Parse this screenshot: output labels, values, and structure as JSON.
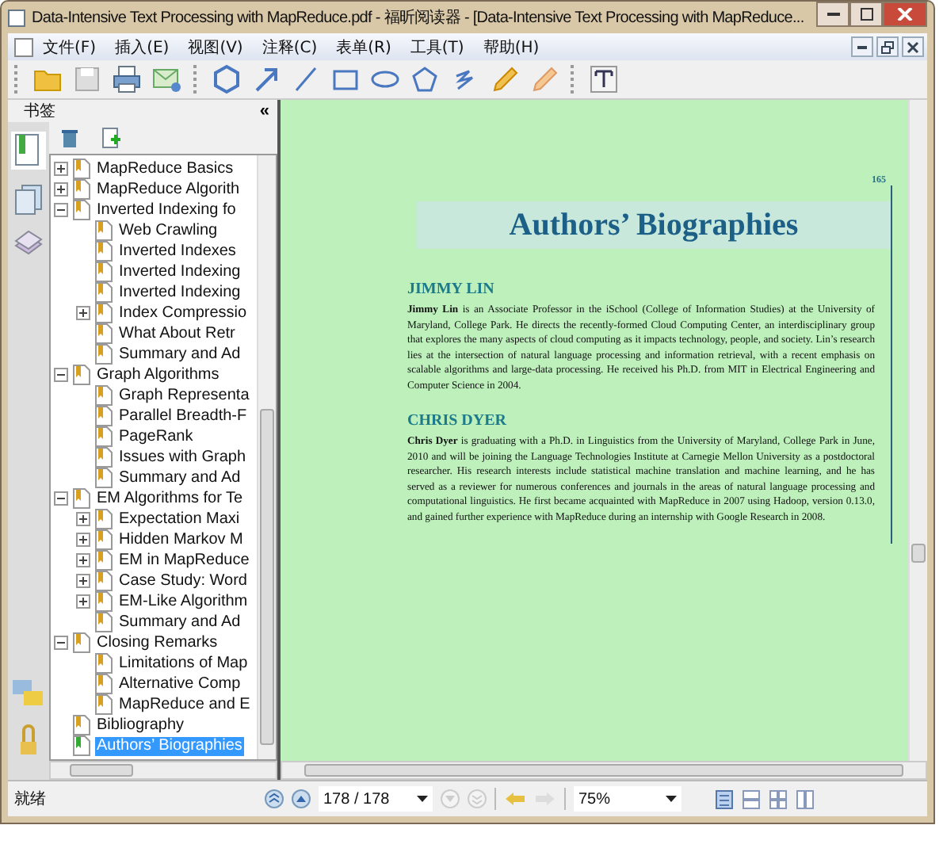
{
  "window": {
    "title": "Data-Intensive Text Processing with MapReduce.pdf - 福昕阅读器 - [Data-Intensive Text Processing with MapReduce..."
  },
  "menu": [
    "文件(F)",
    "插入(E)",
    "视图(V)",
    "注释(C)",
    "表单(R)",
    "工具(T)",
    "帮助(H)"
  ],
  "panel": {
    "title": "书签",
    "collapse": "«"
  },
  "bookmarks": [
    {
      "label": "MapReduce Basics",
      "expanded": false,
      "selected": false
    },
    {
      "label": "MapReduce Algorith",
      "expanded": false,
      "selected": false
    },
    {
      "label": "Inverted Indexing fo",
      "expanded": true,
      "selected": false,
      "children": [
        {
          "label": "Web Crawling",
          "selected": false
        },
        {
          "label": "Inverted Indexes",
          "selected": false
        },
        {
          "label": "Inverted Indexing",
          "selected": false
        },
        {
          "label": "Inverted Indexing",
          "selected": false
        },
        {
          "label": "Index Compressio",
          "expanded": false,
          "selected": false
        },
        {
          "label": "What About Retr",
          "selected": false
        },
        {
          "label": "Summary and Ad",
          "selected": false
        }
      ]
    },
    {
      "label": "Graph Algorithms",
      "expanded": true,
      "selected": false,
      "children": [
        {
          "label": "Graph Representa",
          "selected": false
        },
        {
          "label": "Parallel Breadth-F",
          "selected": false
        },
        {
          "label": "PageRank",
          "selected": false
        },
        {
          "label": "Issues with Graph",
          "selected": false
        },
        {
          "label": "Summary and Ad",
          "selected": false
        }
      ]
    },
    {
      "label": "EM Algorithms for Te",
      "expanded": true,
      "selected": false,
      "children": [
        {
          "label": "Expectation Maxi",
          "expanded": false,
          "selected": false
        },
        {
          "label": "Hidden Markov M",
          "expanded": false,
          "selected": false
        },
        {
          "label": "EM in MapReduce",
          "expanded": false,
          "selected": false
        },
        {
          "label": "Case Study: Word",
          "expanded": false,
          "selected": false
        },
        {
          "label": "EM-Like Algorithm",
          "expanded": false,
          "selected": false
        },
        {
          "label": "Summary and Ad",
          "selected": false
        }
      ]
    },
    {
      "label": "Closing Remarks",
      "expanded": true,
      "selected": false,
      "children": [
        {
          "label": "Limitations of Map",
          "selected": false
        },
        {
          "label": "Alternative Comp",
          "selected": false
        },
        {
          "label": "MapReduce and E",
          "selected": false
        }
      ]
    },
    {
      "label": "Bibliography",
      "selected": false
    },
    {
      "label": "Authors’ Biographies",
      "selected": true
    }
  ],
  "page": {
    "number": "165",
    "title": "Authors’ Biographies",
    "sections": [
      {
        "heading": "JIMMY LIN",
        "text": "**Jimmy Lin** is an Associate Professor in the iSchool (College of Information Studies) at the University of Maryland, College Park. He directs the recently-formed Cloud Computing Center, an interdisciplinary group that explores the many aspects of cloud computing as it impacts technology, people, and society. Lin’s research lies at the intersection of natural language processing and information retrieval, with a recent emphasis on scalable algorithms and large-data processing. He received his Ph.D. from MIT in Electrical Engineering and Computer Science in 2004."
      },
      {
        "heading": "CHRIS DYER",
        "text": "**Chris Dyer** is graduating with a Ph.D. in Linguistics from the University of Maryland, College Park in June, 2010 and will be joining the Language Technologies Institute at Carnegie Mellon University as a postdoctoral researcher. His research interests include statistical machine translation and machine learning, and he has served as a reviewer for numerous conferences and journals in the areas of natural language processing and computational linguistics. He first became acquainted with MapReduce in 2007 using Hadoop, version 0.13.0, and gained further experience with MapReduce during an internship with Google Research in 2008."
      }
    ]
  },
  "status_bar": {
    "text": "就绪",
    "page_field": "178 / 178",
    "zoom": "75%"
  }
}
